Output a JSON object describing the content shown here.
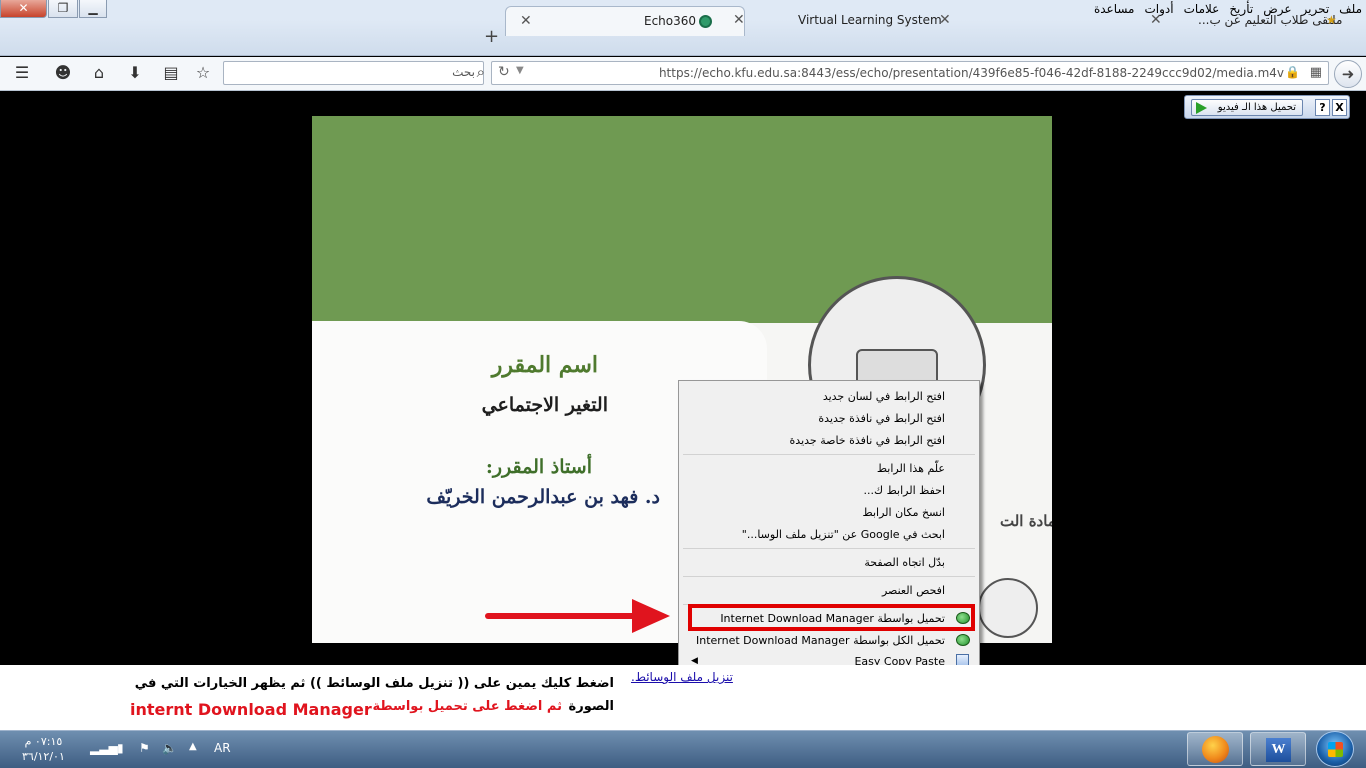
{
  "window": {
    "close_label": "✕",
    "restore_label": "❐",
    "minimize_label": "▁"
  },
  "menubar": [
    "ملف",
    "تحرير",
    "عرض",
    "تأريخ",
    "علامات",
    "أدوات",
    "مساعدة"
  ],
  "tabs": [
    {
      "title": "Echo360",
      "active": true
    },
    {
      "title": "Virtual Learning System",
      "active": false
    },
    {
      "title": "ملتقى طلاب التعليم عن ب...",
      "active": false
    }
  ],
  "newtab_label": "+",
  "nav": {
    "search_placeholder": "بحث",
    "url": "https://echo.kfu.edu.sa:8443/ess/echo/presentation/439f6e85-f046-42df-8188-2249ccc9d02/media.m4v"
  },
  "idm_bar": {
    "download_label": "تحميل هذا الـ فيديو",
    "help_label": "?",
    "close_label": "X"
  },
  "slide": {
    "course_label": "اسم المقرر",
    "course_name": "التغير الاجتماعي",
    "instructor_label": "أستاذ المقرر:",
    "instructor_name": "د.  فهد بن عبدالرحمن الخريّف",
    "deanship_partial": "عمادة الت"
  },
  "context_menu": {
    "items": [
      "افتح الرابط في لسان جديد",
      "افتح الرابط في نافذة جديدة",
      "افتح الرابط في نافذة خاصة جديدة",
      "علّم هذا الرابط",
      "احفظ الرابط ك...",
      "انسخ مكان الرابط",
      "ابحث في Google عن \"تنزيل ملف الوسا...\"",
      "بدّل اتجاه الصفحة",
      "افحص العنصر",
      "تحميل بواسطة Internet Download Manager",
      "تحميل الكل بواسطة Internet Download Manager",
      "Easy Copy Paste"
    ]
  },
  "bottom": {
    "link_text": "تنزيل ملف الوسائط.",
    "line1": "اضغط كليك يمين على (( تنزيل ملف الوسائط ))  ثم يظهر الخيارات التي في",
    "line2_black": "الصورة",
    "line2_red": "ثم اضغط على تحميل بواسطة",
    "line2_red_en": "internt Download Manager"
  },
  "taskbar": {
    "time": "٠٧:١٥ م",
    "date": "٣٦/١٢/٠١",
    "lang": "AR"
  },
  "colors": {
    "slide_green": "#6f9a52",
    "highlight_red": "#e00000",
    "arrow_red": "#e0141e",
    "link_blue": "#1a0dab"
  }
}
